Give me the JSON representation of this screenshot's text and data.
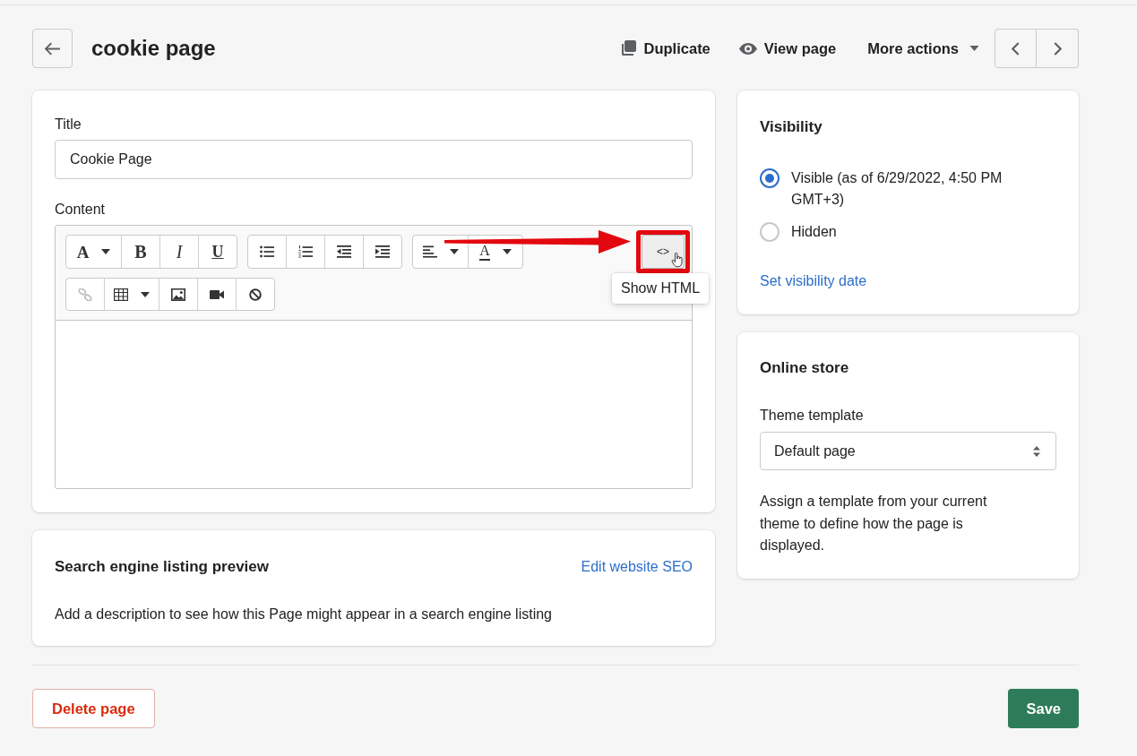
{
  "header": {
    "title": "cookie page",
    "actions": [
      {
        "kind": "duplicate",
        "label": "Duplicate"
      },
      {
        "kind": "view",
        "label": "View page"
      },
      {
        "kind": "menu",
        "label": "More actions"
      }
    ]
  },
  "content_card": {
    "title_label": "Title",
    "title_value": "Cookie Page",
    "content_label": "Content",
    "editor": {
      "toolbar": [
        [
          [
            {
              "kind": "font",
              "label": "A",
              "dropdown": true,
              "disabled": false
            },
            {
              "kind": "bold",
              "label": "B",
              "dropdown": false,
              "disabled": false
            },
            {
              "kind": "italic",
              "label": "I",
              "dropdown": false,
              "disabled": false
            },
            {
              "kind": "underline",
              "label": "U",
              "dropdown": false,
              "disabled": false
            }
          ],
          [
            {
              "kind": "bullets",
              "dropdown": false,
              "disabled": false
            },
            {
              "kind": "numbers",
              "dropdown": false,
              "disabled": false
            },
            {
              "kind": "outdent",
              "dropdown": false,
              "disabled": false
            },
            {
              "kind": "indent",
              "dropdown": false,
              "disabled": false
            }
          ],
          [
            {
              "kind": "align",
              "dropdown": true,
              "disabled": false
            },
            {
              "kind": "color",
              "label": "A",
              "dropdown": true,
              "disabled": false
            }
          ]
        ],
        [
          [
            {
              "kind": "link",
              "dropdown": false,
              "disabled": true
            },
            {
              "kind": "table",
              "dropdown": true,
              "disabled": false
            },
            {
              "kind": "image",
              "dropdown": false,
              "disabled": false
            },
            {
              "kind": "video",
              "dropdown": false,
              "disabled": false
            },
            {
              "kind": "clear",
              "dropdown": false,
              "disabled": false
            }
          ]
        ]
      ],
      "html_button": {
        "label": "<>",
        "hovered": true,
        "tooltip": "Show HTML"
      }
    }
  },
  "annotation": {
    "arrow": true,
    "highlight": true,
    "cursor": true
  },
  "seo": {
    "title": "Search engine listing preview",
    "link": "Edit website SEO",
    "text": "Add a description to see how this Page might appear in a search engine listing"
  },
  "visibility": {
    "title": "Visibility",
    "options": [
      {
        "label": "Visible (as of 6/29/2022, 4:50 PM GMT+3)",
        "selected": true
      },
      {
        "label": "Hidden",
        "selected": false
      }
    ],
    "link": "Set visibility date"
  },
  "online_store": {
    "title": "Online store",
    "template_label": "Theme template",
    "template_value": "Default page",
    "help": "Assign a template from your current theme to define how the page is displayed."
  },
  "footer": {
    "delete": "Delete page",
    "save": "Save"
  }
}
